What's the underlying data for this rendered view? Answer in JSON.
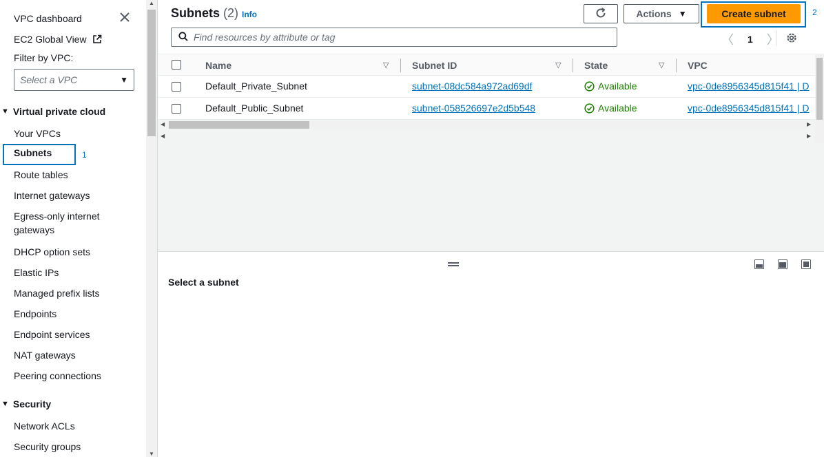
{
  "sidebar": {
    "vpc_dashboard": "VPC dashboard",
    "ec2_global_view": "EC2 Global View",
    "filter_label": "Filter by VPC:",
    "vpc_select_placeholder": "Select a VPC",
    "section_vpc": "Virtual private cloud",
    "items_vpc": [
      "Your VPCs",
      "Subnets",
      "Route tables",
      "Internet gateways",
      "Egress-only internet gateways",
      "DHCP option sets",
      "Elastic IPs",
      "Managed prefix lists",
      "Endpoints",
      "Endpoint services",
      "NAT gateways",
      "Peering connections"
    ],
    "active_item_badge": "1",
    "section_security": "Security",
    "items_security": [
      "Network ACLs",
      "Security groups"
    ]
  },
  "header": {
    "title": "Subnets",
    "count": "(2)",
    "info": "Info",
    "actions_label": "Actions",
    "create_label": "Create subnet",
    "create_badge": "2",
    "search_placeholder": "Find resources by attribute or tag",
    "page_number": "1"
  },
  "table": {
    "columns": [
      "Name",
      "Subnet ID",
      "State",
      "VPC"
    ],
    "rows": [
      {
        "name": "Default_Private_Subnet",
        "subnet_id": "subnet-08dc584a972ad69df",
        "state": "Available",
        "vpc": "vpc-0de8956345d815f41 | D"
      },
      {
        "name": "Default_Public_Subnet",
        "subnet_id": "subnet-058526697e2d5b548",
        "state": "Available",
        "vpc": "vpc-0de8956345d815f41 | D"
      }
    ]
  },
  "split_panel": {
    "title": "Select a subnet"
  },
  "colors": {
    "accent": "#0073bb",
    "primary_button": "#ff9900",
    "success": "#1d8102"
  }
}
